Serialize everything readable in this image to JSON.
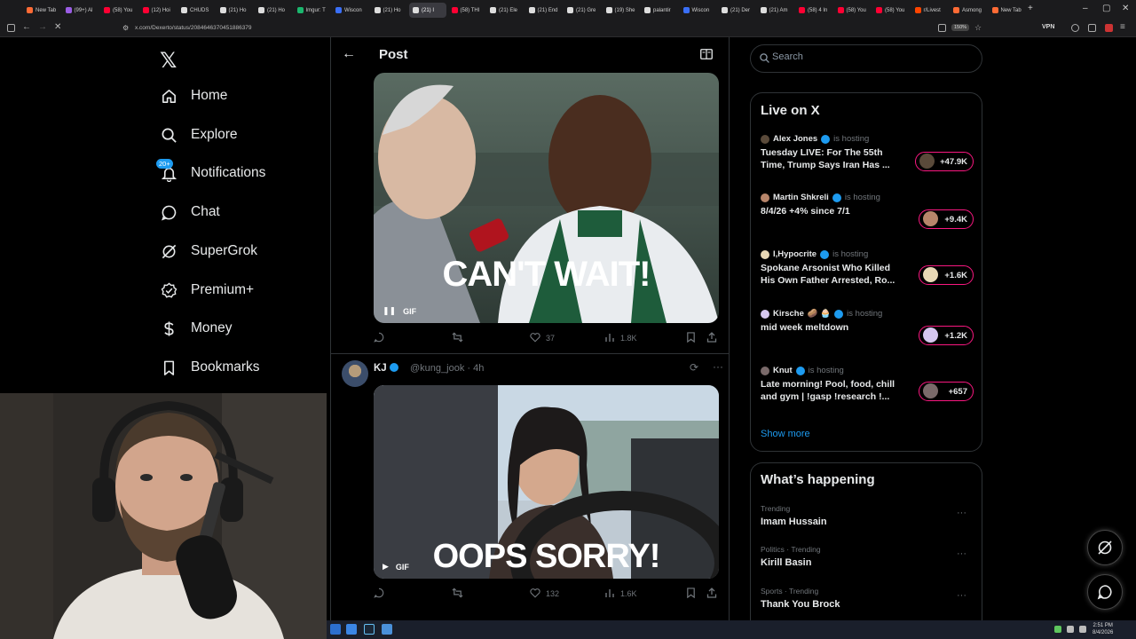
{
  "browser": {
    "tabs": [
      {
        "label": "New Tab",
        "color": "#ff6b35"
      },
      {
        "label": "(99+) Al",
        "color": "#9b5de5"
      },
      {
        "label": "(58) You",
        "color": "#ff0033"
      },
      {
        "label": "(12) Hoi",
        "color": "#ff0033"
      },
      {
        "label": "CHUDS",
        "color": "#dddddd"
      },
      {
        "label": "(21) Ho",
        "color": "#dddddd"
      },
      {
        "label": "(21) Ho",
        "color": "#dddddd"
      },
      {
        "label": "Imgur: T",
        "color": "#1bb76e"
      },
      {
        "label": "Wiscon",
        "color": "#3a6ff7"
      },
      {
        "label": "(21) Ho",
        "color": "#dddddd"
      },
      {
        "label": "(21) I",
        "color": "#dddddd"
      },
      {
        "label": "(58) THI",
        "color": "#ff0033"
      },
      {
        "label": "(21) Ele",
        "color": "#dddddd"
      },
      {
        "label": "(21) End",
        "color": "#dddddd"
      },
      {
        "label": "(21) Gre",
        "color": "#dddddd"
      },
      {
        "label": "(19) She",
        "color": "#dddddd"
      },
      {
        "label": "palantir",
        "color": "#dddddd"
      },
      {
        "label": "Wiscon",
        "color": "#3a6ff7"
      },
      {
        "label": "(21) Der",
        "color": "#dddddd"
      },
      {
        "label": "(21) Am",
        "color": "#dddddd"
      },
      {
        "label": "(58) 4 In",
        "color": "#ff0033"
      },
      {
        "label": "(58) You",
        "color": "#ff0033"
      },
      {
        "label": "(58) You",
        "color": "#ff0033"
      },
      {
        "label": "r/Livest",
        "color": "#ff4500"
      },
      {
        "label": "Asmong",
        "color": "#ff6b35"
      },
      {
        "label": "New Tab",
        "color": "#ff6b35"
      }
    ],
    "active_tab_index": 10,
    "url": "x.com/Dexerto/status/2084646370451886379",
    "zoom": "150%",
    "vpn_label": "VPN"
  },
  "nav": {
    "items": [
      {
        "label": "Home",
        "icon": "home-icon"
      },
      {
        "label": "Explore",
        "icon": "search-icon"
      },
      {
        "label": "Notifications",
        "icon": "bell-icon",
        "badge": "20+"
      },
      {
        "label": "Chat",
        "icon": "chat-icon"
      },
      {
        "label": "SuperGrok",
        "icon": "grok-icon"
      },
      {
        "label": "Premium+",
        "icon": "premium-icon"
      },
      {
        "label": "Money",
        "icon": "dollar-icon"
      },
      {
        "label": "Bookmarks",
        "icon": "bookmark-icon"
      }
    ]
  },
  "post": {
    "header_title": "Post",
    "first_media": {
      "caption": "CAN'T WAIT!",
      "badge": "GIF"
    },
    "first_actions": {
      "replies": "",
      "reposts": "",
      "likes": "37",
      "views": "1.8K"
    },
    "tweet": {
      "name": "KJ",
      "handle": "@kung_jook",
      "time": "4h",
      "media_caption": "OOPS SORRY!",
      "badge": "GIF",
      "actions": {
        "replies": "",
        "reposts": "",
        "likes": "132",
        "views": "1.6K"
      }
    }
  },
  "sidebar": {
    "search_placeholder": "Search",
    "live": {
      "title": "Live on X",
      "hosting_text": "is hosting",
      "items": [
        {
          "host": "Alex Jones",
          "extra": "",
          "text": "Tuesday LIVE: For The 55th\nTime, Trump Says Iran Has ...",
          "count": "+47.9K"
        },
        {
          "host": "Martin Shkreli",
          "extra": "",
          "text": "8/4/26 +4% since 7/1",
          "count": "+9.4K"
        },
        {
          "host": "I,Hypocrite",
          "extra": "",
          "text": "Spokane Arsonist Who Killed\nHis Own Father Arrested, Ro...",
          "count": "+1.6K"
        },
        {
          "host": "Kirsche",
          "extra": "🥔 🧁",
          "text": "mid week meltdown",
          "count": "+1.2K"
        },
        {
          "host": "Knut",
          "extra": "",
          "text": "Late morning! Pool, food, chill\nand gym | !gasp !research !...",
          "count": "+657"
        }
      ],
      "show_more": "Show more"
    },
    "happening": {
      "title": "What’s happening",
      "trends": [
        {
          "context": "Trending",
          "name": "Imam Hussain"
        },
        {
          "context": "Politics · Trending",
          "name": "Kirill Basin"
        },
        {
          "context": "Sports · Trending",
          "name": "Thank You Brock"
        }
      ]
    }
  },
  "taskbar": {
    "time": "2:51 PM",
    "date": "8/4/2026"
  },
  "colors": {
    "accent": "#1d9bf0",
    "live_pink": "#f91880",
    "border": "#2f3336",
    "muted": "#71767b"
  }
}
